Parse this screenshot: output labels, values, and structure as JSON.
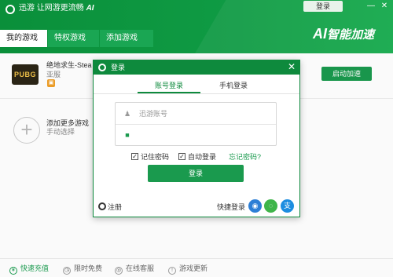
{
  "app": {
    "title": "迅游",
    "slogan": "让网游更流畅",
    "ai_tag": "AI",
    "login_button": "登录",
    "brand_prefix": "AI",
    "brand_text": "智能加速",
    "minimize_glyph": "—",
    "close_glyph": "✕"
  },
  "tabs": [
    {
      "label": "我的游戏",
      "active": true
    },
    {
      "label": "特权游戏",
      "active": false
    },
    {
      "label": "添加游戏",
      "active": false
    }
  ],
  "game": {
    "icon_text": "PUBG",
    "name": "绝地求生-Stea",
    "region": "亚服",
    "accelerate_button": "启动加速"
  },
  "add_game": {
    "plus": "+",
    "label": "添加更多游戏",
    "sub": "手动选择"
  },
  "footer": [
    {
      "label": "快速充值",
      "icon": "yen-icon",
      "glyph": "¥"
    },
    {
      "label": "限时免费",
      "icon": "clock-icon",
      "glyph": "◷"
    },
    {
      "label": "在线客服",
      "icon": "headset-icon",
      "glyph": "◎"
    },
    {
      "label": "游戏更新",
      "icon": "update-icon",
      "glyph": "↑"
    }
  ],
  "dialog": {
    "title": "登录",
    "close_glyph": "✕",
    "tabs": [
      "账号登录",
      "手机登录"
    ],
    "account_placeholder": "迅游账号",
    "password_placeholder": "",
    "remember_password": "记住密码",
    "auto_login": "自动登录",
    "forgot_password": "忘记密码?",
    "submit": "登录",
    "register": "注册",
    "quick_login": "快捷登录",
    "check_glyph": "✓",
    "social": [
      {
        "name": "qq-icon",
        "glyph": "◉"
      },
      {
        "name": "wechat-icon",
        "glyph": "◌"
      },
      {
        "name": "alipay-icon",
        "glyph": "支"
      }
    ]
  },
  "colors": {
    "brand_green": "#0e8a3d",
    "button_green": "#1a9a4e",
    "qq_blue": "#2d7fd6",
    "wechat_green": "#3fb54a",
    "alipay_blue": "#1d8de0"
  }
}
